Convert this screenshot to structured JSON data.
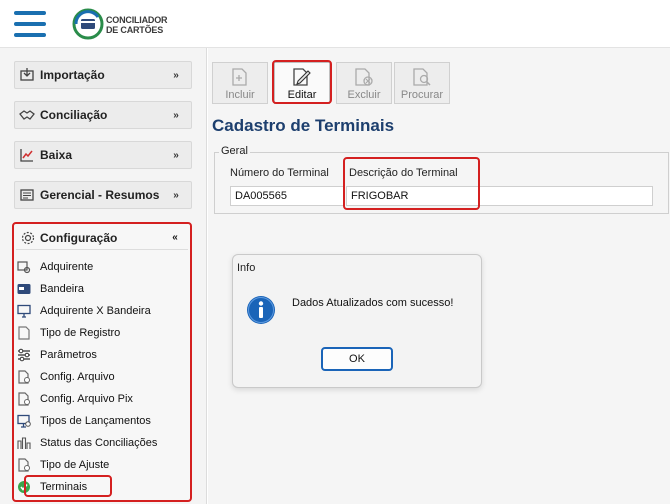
{
  "header": {
    "logo_line1": "CONCILIADOR",
    "logo_line2": "DE CARTÕES",
    "brand_color": "#1a6fb0",
    "menu_icon": "hamburger-icon"
  },
  "sidebar": {
    "groups": [
      {
        "label": "Importação",
        "icon": "import-icon",
        "state": "collapsed"
      },
      {
        "label": "Conciliação",
        "icon": "handshake-icon",
        "state": "collapsed"
      },
      {
        "label": "Baixa",
        "icon": "chart-icon",
        "state": "collapsed"
      },
      {
        "label": "Gerencial - Resumos",
        "icon": "folder-icon",
        "state": "collapsed"
      }
    ],
    "config": {
      "label": "Configuração",
      "icon": "gear-icon",
      "state": "expanded",
      "items": [
        {
          "label": "Adquirente",
          "icon": "adquirente-icon"
        },
        {
          "label": "Bandeira",
          "icon": "bandeira-icon"
        },
        {
          "label": "Adquirente X Bandeira",
          "icon": "monitor-card-icon"
        },
        {
          "label": "Tipo de Registro",
          "icon": "document-icon"
        },
        {
          "label": "Parâmetros",
          "icon": "sliders-icon"
        },
        {
          "label": "Config. Arquivo",
          "icon": "file-gear-icon"
        },
        {
          "label": "Config. Arquivo Pix",
          "icon": "file-gear-icon"
        },
        {
          "label": "Tipos de Lançamentos",
          "icon": "monitor-gear-icon"
        },
        {
          "label": "Status das Conciliações",
          "icon": "status-icon"
        },
        {
          "label": "Tipo de Ajuste",
          "icon": "file-gear-icon"
        },
        {
          "label": "Terminais",
          "icon": "check-circle-icon"
        }
      ]
    }
  },
  "toolbar": {
    "incluir": "Incluir",
    "editar": "Editar",
    "excluir": "Excluir",
    "procurar": "Procurar"
  },
  "page": {
    "title": "Cadastro de Terminais",
    "group_label": "Geral",
    "numero_label": "Número do Terminal",
    "numero_value": "DA005565",
    "descricao_label": "Descrição do Terminal",
    "descricao_value": "FRIGOBAR"
  },
  "dialog": {
    "title": "Info",
    "message": "Dados Atualizados com sucesso!",
    "ok_label": "OK",
    "icon": "info-icon"
  },
  "colors": {
    "highlight": "#d42020",
    "title": "#1d3f6e",
    "info_blue": "#1a64b8"
  }
}
